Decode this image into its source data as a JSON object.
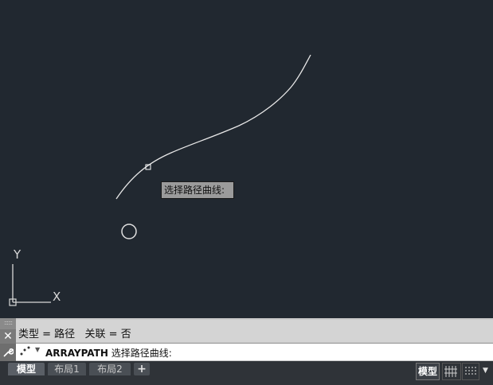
{
  "canvas": {
    "tooltip": "选择路径曲线:",
    "ucs": {
      "x_label": "X",
      "y_label": "Y"
    }
  },
  "command_line": {
    "history": "类型 = 路径   关联 = 否",
    "command_name": "ARRAYPATH",
    "prompt": "选择路径曲线:",
    "close_glyph": "✕",
    "tool_glyph": "🔧"
  },
  "layout_tabs": [
    {
      "label": "模型",
      "active": true
    },
    {
      "label": "布局1",
      "active": false
    },
    {
      "label": "布局2",
      "active": false
    }
  ],
  "add_tab_label": "+",
  "status": {
    "space_label": "模型"
  },
  "colors": {
    "canvas_bg": "#212830",
    "curve": "#e8e8e8",
    "tooltip_bg": "#9b9b9b"
  }
}
